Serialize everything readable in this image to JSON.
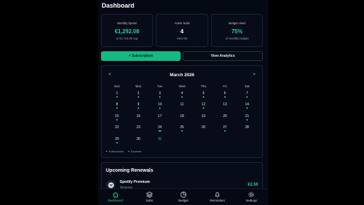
{
  "header": {
    "title": "Dashboard"
  },
  "cards": [
    {
      "label": "Monthly Spend",
      "value": "€1,292.08",
      "sub": "of €1,714.00 cap"
    },
    {
      "label": "Active Subs",
      "value": "4",
      "sub": "View list"
    },
    {
      "label": "Budget Used",
      "value": "75%",
      "sub": "of monthly budget"
    }
  ],
  "actions": {
    "add_label": "+ Subscription",
    "analytics_label": "View Analytics"
  },
  "calendar": {
    "month": "March 2026",
    "prev": "<",
    "next": ">",
    "weekdays": [
      "Sun",
      "Mon",
      "Tue",
      "Wed",
      "Thu",
      "Fri",
      "Sat"
    ],
    "weeks": [
      [
        {
          "d": "1",
          "m": "s"
        },
        {
          "d": "2",
          "m": "s"
        },
        {
          "d": "3",
          "m": "s"
        },
        {
          "d": "4",
          "m": "s"
        },
        {
          "d": "5",
          "m": "s"
        },
        {
          "d": "6",
          "m": "s"
        },
        {
          "d": "7",
          "m": "s"
        }
      ],
      [
        {
          "d": "8",
          "m": "s"
        },
        {
          "d": "9",
          "m": "s"
        },
        {
          "d": "10",
          "m": "s"
        },
        {
          "d": "11",
          "m": ""
        },
        {
          "d": "12",
          "m": "s"
        },
        {
          "d": "13",
          "m": ""
        },
        {
          "d": "14",
          "m": "s"
        }
      ],
      [
        {
          "d": "15",
          "m": "s"
        },
        {
          "d": "16",
          "m": ""
        },
        {
          "d": "17",
          "m": ""
        },
        {
          "d": "18",
          "m": ""
        },
        {
          "d": "19",
          "m": ""
        },
        {
          "d": "20",
          "m": ""
        },
        {
          "d": "21",
          "m": "s"
        }
      ],
      [
        {
          "d": "22",
          "m": ""
        },
        {
          "d": "23",
          "m": ""
        },
        {
          "d": "24",
          "m": "ss"
        },
        {
          "d": "25",
          "m": "s"
        },
        {
          "d": "26",
          "m": ""
        },
        {
          "d": "27",
          "m": "s"
        },
        {
          "d": "28",
          "m": ""
        }
      ],
      [
        {
          "d": "29",
          "m": "s"
        },
        {
          "d": "30",
          "m": ""
        },
        {
          "d": "31",
          "m": "",
          "today": true
        }
      ]
    ],
    "legend": {
      "subscription": "Subscription",
      "expense": "Expense"
    },
    "colors": {
      "subscription": "#2bd39a",
      "expense": "#8a93a6"
    }
  },
  "renewals": {
    "title": "Upcoming Renewals",
    "items": [
      {
        "name": "Spotify Premium",
        "when": "Tomorrow",
        "amount": "€2.50",
        "icon": "spotify-icon"
      }
    ]
  },
  "tabs": [
    {
      "label": "Dashboard",
      "icon": "home-icon",
      "active": true
    },
    {
      "label": "Subs",
      "icon": "layers-icon",
      "active": false
    },
    {
      "label": "Budget",
      "icon": "pie-icon",
      "active": false
    },
    {
      "label": "Reminders",
      "icon": "bell-icon",
      "active": false
    },
    {
      "label": "Settings",
      "icon": "gear-icon",
      "active": false
    }
  ],
  "theme": {
    "accent": "#2bd39a",
    "background": "#050914"
  }
}
